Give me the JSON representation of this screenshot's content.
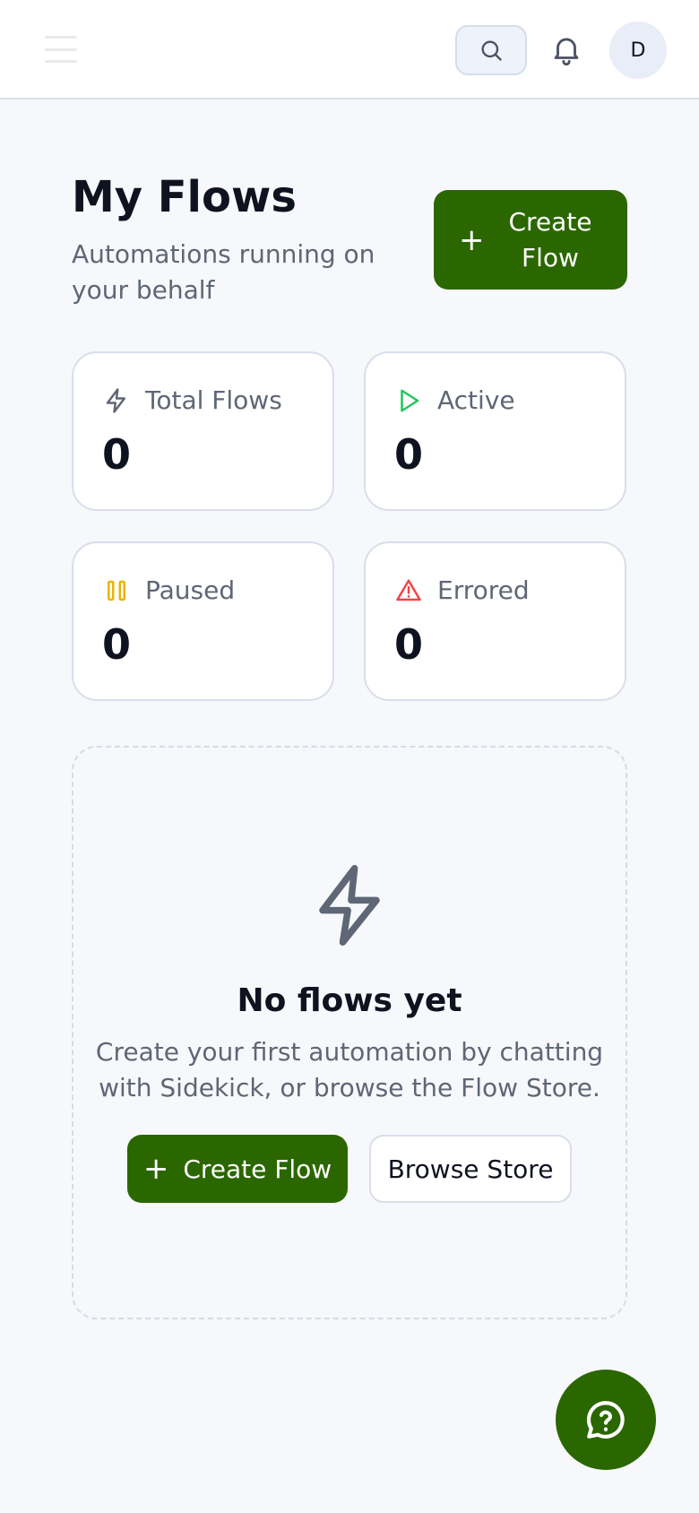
{
  "header": {
    "search_icon": "search-icon",
    "bell_icon": "bell-icon",
    "avatar_initial": "D"
  },
  "page": {
    "title": "My Flows",
    "subtitle": "Automations running on your behalf",
    "create_button": {
      "plus": "+",
      "label": "Create Flow"
    }
  },
  "stats": [
    {
      "label": "Total Flows",
      "value": "0",
      "icon": "bolt-icon",
      "color": "#5f6675"
    },
    {
      "label": "Active",
      "value": "0",
      "icon": "play-icon",
      "color": "#22c55e"
    },
    {
      "label": "Paused",
      "value": "0",
      "icon": "pause-icon",
      "color": "#eab308"
    },
    {
      "label": "Errored",
      "value": "0",
      "icon": "warning-icon",
      "color": "#ef4444"
    }
  ],
  "empty_state": {
    "icon": "bolt-icon",
    "title": "No flows yet",
    "description": "Create your first automation by chatting with Sidekick, or browse the Flow Store.",
    "create_button": {
      "plus": "+",
      "label": "Create Flow"
    },
    "browse_button": "Browse Store"
  },
  "help_fab": {
    "icon": "help-chat-icon"
  },
  "colors": {
    "accent": "#2b6700",
    "background": "#f7f8fb"
  }
}
